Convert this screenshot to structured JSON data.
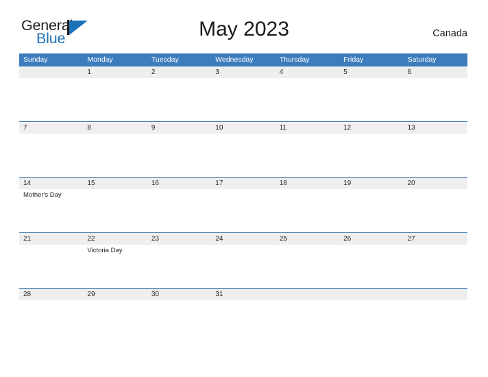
{
  "brand": {
    "name_part1": "General",
    "name_part2": "Blue",
    "accent_color": "#1d71b8",
    "mark_icon": "triangle-flag-icon"
  },
  "header": {
    "title": "May 2023",
    "region": "Canada"
  },
  "theme": {
    "header_row_bg": "#3d7cbd",
    "date_band_bg": "#efeff0",
    "divider_color": "#2e6da4",
    "text_color": "#231f20",
    "page_bg": "#ffffff"
  },
  "calendar": {
    "month": "May",
    "year": "2023",
    "weekday_headers": [
      "Sunday",
      "Monday",
      "Tuesday",
      "Wednesday",
      "Thursday",
      "Friday",
      "Saturday"
    ],
    "weeks": [
      {
        "days": [
          {
            "number": "",
            "events": []
          },
          {
            "number": "1",
            "events": []
          },
          {
            "number": "2",
            "events": []
          },
          {
            "number": "3",
            "events": []
          },
          {
            "number": "4",
            "events": []
          },
          {
            "number": "5",
            "events": []
          },
          {
            "number": "6",
            "events": []
          }
        ]
      },
      {
        "days": [
          {
            "number": "7",
            "events": []
          },
          {
            "number": "8",
            "events": []
          },
          {
            "number": "9",
            "events": []
          },
          {
            "number": "10",
            "events": []
          },
          {
            "number": "11",
            "events": []
          },
          {
            "number": "12",
            "events": []
          },
          {
            "number": "13",
            "events": []
          }
        ]
      },
      {
        "days": [
          {
            "number": "14",
            "events": [
              "Mother's Day"
            ]
          },
          {
            "number": "15",
            "events": []
          },
          {
            "number": "16",
            "events": []
          },
          {
            "number": "17",
            "events": []
          },
          {
            "number": "18",
            "events": []
          },
          {
            "number": "19",
            "events": []
          },
          {
            "number": "20",
            "events": []
          }
        ]
      },
      {
        "days": [
          {
            "number": "21",
            "events": []
          },
          {
            "number": "22",
            "events": [
              "Victoria Day"
            ]
          },
          {
            "number": "23",
            "events": []
          },
          {
            "number": "24",
            "events": []
          },
          {
            "number": "25",
            "events": []
          },
          {
            "number": "26",
            "events": []
          },
          {
            "number": "27",
            "events": []
          }
        ]
      },
      {
        "days": [
          {
            "number": "28",
            "events": []
          },
          {
            "number": "29",
            "events": []
          },
          {
            "number": "30",
            "events": []
          },
          {
            "number": "31",
            "events": []
          },
          {
            "number": "",
            "events": []
          },
          {
            "number": "",
            "events": []
          },
          {
            "number": "",
            "events": []
          }
        ]
      }
    ]
  }
}
